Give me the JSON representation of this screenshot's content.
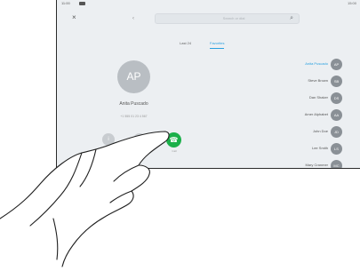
{
  "status": {
    "left": "11:00",
    "right": "15:00"
  },
  "header": {
    "back": "×",
    "prev": "‹",
    "search_placeholder": "Search or dial",
    "search_icon": "search-icon"
  },
  "tabs": [
    {
      "label": "Last 24"
    },
    {
      "label": "Favorites"
    }
  ],
  "contact": {
    "initials": "AP",
    "name": "Anita Puscado",
    "number": "+1 555 01 23 4 567",
    "actions": [
      {
        "label": "Info",
        "icon": "info-icon"
      },
      {
        "label": "Video",
        "icon": "video-icon"
      },
      {
        "label": "Call",
        "icon": "phone-icon"
      }
    ]
  },
  "favorites": [
    {
      "name": "Anita Puscado",
      "initials": "AP",
      "selected": true
    },
    {
      "name": "Steve Brown",
      "initials": "SB"
    },
    {
      "name": "Dan Shaker",
      "initials": "DS"
    },
    {
      "name": "Amer Alphabet",
      "initials": "AA"
    },
    {
      "name": "John Doe",
      "initials": "JD"
    },
    {
      "name": "Lee Smith",
      "initials": "LS"
    },
    {
      "name": "Mary Cranmer",
      "initials": "MC"
    }
  ],
  "colors": {
    "accent": "#2aa1e0",
    "call_green": "#1bb04a",
    "screen_bg": "#eceff2"
  }
}
